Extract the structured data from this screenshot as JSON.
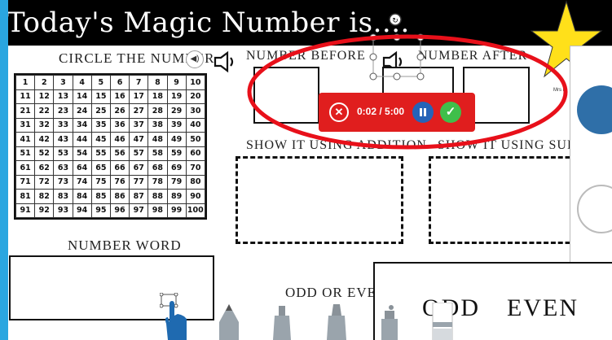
{
  "header": {
    "title": "Today's Magic Number is...."
  },
  "labels": {
    "circle_number": "CIRCLE THE NUMBER",
    "number_before": "NUMBER BEFORE",
    "number_after": "NUMBER AFTER",
    "addition": "SHOW IT USING ADDITION",
    "subtraction": "SHOW IT USING SUBTRACT",
    "number_word": "NUMBER WORD",
    "odd_or_even": "ODD OR EVEN",
    "odd": "ODD",
    "even": "EVEN"
  },
  "hundred_grid": [
    [
      "1",
      "2",
      "3",
      "4",
      "5",
      "6",
      "7",
      "8",
      "9",
      "10"
    ],
    [
      "11",
      "12",
      "13",
      "14",
      "15",
      "16",
      "17",
      "18",
      "19",
      "20"
    ],
    [
      "21",
      "22",
      "23",
      "24",
      "25",
      "26",
      "27",
      "28",
      "29",
      "30"
    ],
    [
      "31",
      "32",
      "33",
      "34",
      "35",
      "36",
      "37",
      "38",
      "39",
      "40"
    ],
    [
      "41",
      "42",
      "43",
      "44",
      "45",
      "46",
      "47",
      "48",
      "49",
      "50"
    ],
    [
      "51",
      "52",
      "53",
      "54",
      "55",
      "56",
      "57",
      "58",
      "59",
      "60"
    ],
    [
      "61",
      "62",
      "63",
      "64",
      "65",
      "66",
      "67",
      "68",
      "69",
      "70"
    ],
    [
      "71",
      "72",
      "73",
      "74",
      "75",
      "76",
      "77",
      "78",
      "79",
      "80"
    ],
    [
      "81",
      "82",
      "83",
      "84",
      "85",
      "86",
      "87",
      "88",
      "89",
      "90"
    ],
    [
      "91",
      "92",
      "93",
      "94",
      "95",
      "96",
      "97",
      "98",
      "99",
      "100"
    ]
  ],
  "recorder": {
    "time": "0:02 / 5:00"
  },
  "side_panel": {
    "name": "Mrs P"
  },
  "colors": {
    "recorder_bg": "#e01e1e",
    "annotation_red": "#e8101a",
    "star": "#ffe01a",
    "pause": "#2563b8",
    "done": "#3fbf4a"
  },
  "icons": [
    "speaker-icon",
    "sound-button-icon",
    "star-icon",
    "close-icon",
    "pause-icon",
    "check-icon",
    "hand-cursor-icon",
    "pencil-icon",
    "marker-icon",
    "highlighter-icon",
    "eraser-icon",
    "rotate-icon"
  ]
}
